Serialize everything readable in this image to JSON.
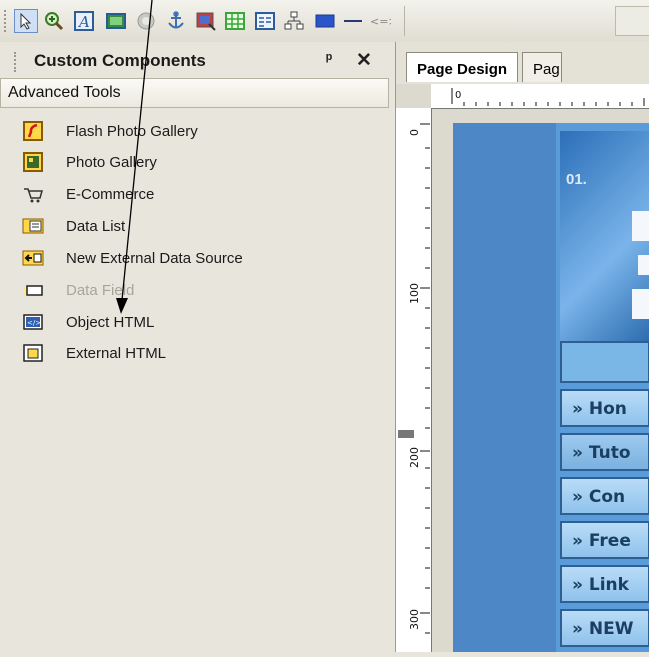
{
  "toolbar": {
    "buttons": [
      "pointer-icon",
      "zoom-icon",
      "text-icon",
      "image-icon",
      "shape-icon",
      "anchor-icon",
      "photo-icon",
      "table-icon",
      "form-icon",
      "sitemap-icon",
      "rectangle-icon",
      "line-icon",
      "code-icon"
    ]
  },
  "panel": {
    "title": "Custom Components",
    "pin": "ᵖ",
    "close": "✕",
    "section": "Advanced Tools",
    "items": [
      {
        "label": "Flash Photo Gallery",
        "icon": "flash-gallery-icon",
        "enabled": true
      },
      {
        "label": "Photo Gallery",
        "icon": "photo-gallery-icon",
        "enabled": true
      },
      {
        "label": "E-Commerce",
        "icon": "cart-icon",
        "enabled": true
      },
      {
        "label": "Data List",
        "icon": "data-list-icon",
        "enabled": true
      },
      {
        "label": "New External Data Source",
        "icon": "external-source-icon",
        "enabled": true
      },
      {
        "label": "Data Field",
        "icon": "data-field-icon",
        "enabled": false
      },
      {
        "label": "Object HTML",
        "icon": "object-html-icon",
        "enabled": true
      },
      {
        "label": "External HTML",
        "icon": "external-html-icon",
        "enabled": true
      }
    ]
  },
  "design": {
    "tabs": [
      "Page Design",
      "Pag"
    ],
    "ruler_h": "0",
    "ruler_v": [
      "0",
      "100",
      "200",
      "300"
    ],
    "header_text": "01.",
    "menu": [
      "» Hon",
      "» Tuto",
      "» Con",
      "» Free",
      "» Link",
      "» NEW"
    ]
  }
}
